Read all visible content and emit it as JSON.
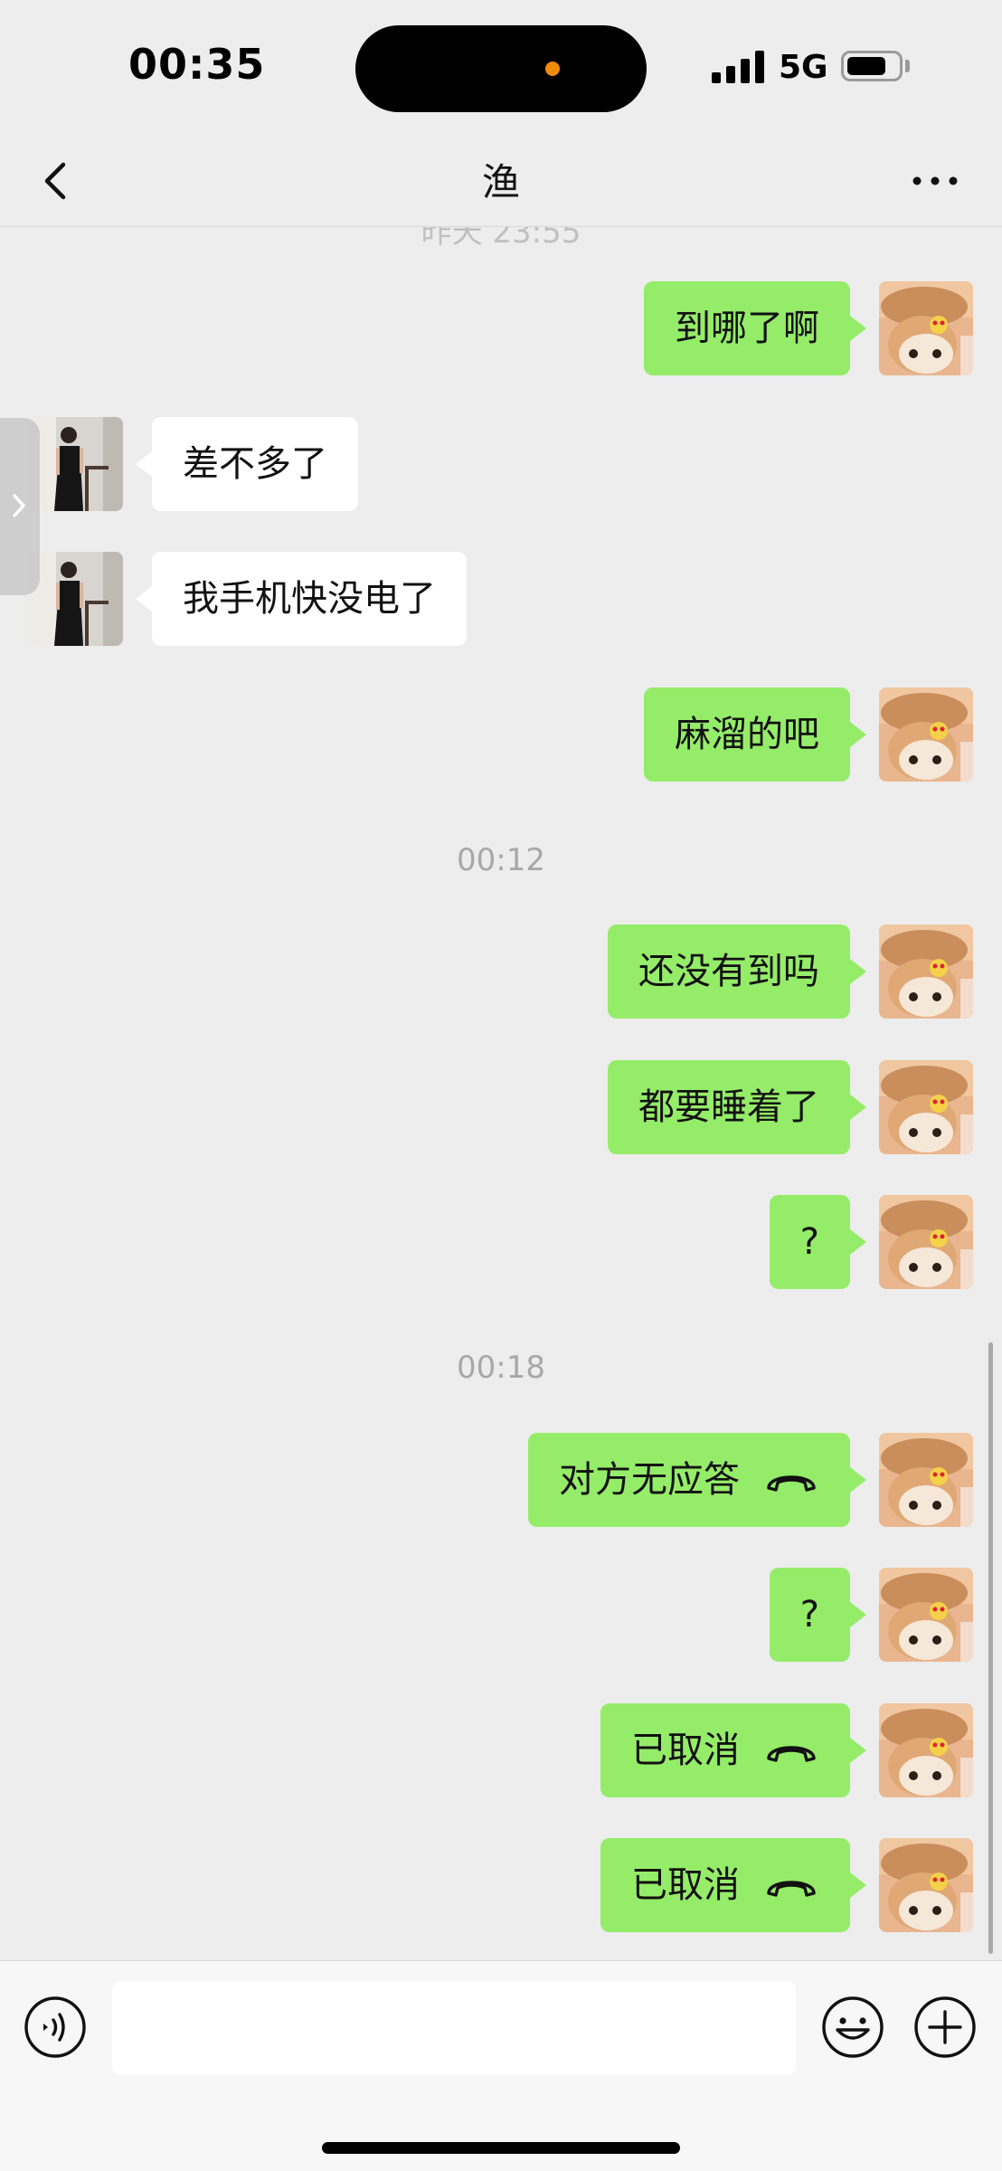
{
  "status_bar": {
    "time": "00:35",
    "network": "5G"
  },
  "header": {
    "title": "渔"
  },
  "chat": {
    "cut_timestamp": "昨天 23:55",
    "timestamps": [
      "00:12",
      "00:18"
    ],
    "messages": [
      {
        "sender": "me",
        "text": "到哪了啊"
      },
      {
        "sender": "them",
        "text": "差不多了"
      },
      {
        "sender": "them",
        "text": "我手机快没电了"
      },
      {
        "sender": "me",
        "text": "麻溜的吧"
      },
      {
        "sender": "me",
        "text": "还没有到吗"
      },
      {
        "sender": "me",
        "text": "都要睡着了"
      },
      {
        "sender": "me",
        "text": "?"
      },
      {
        "sender": "me",
        "text": "对方无应答",
        "icon": "phone-hangup-icon"
      },
      {
        "sender": "me",
        "text": "?"
      },
      {
        "sender": "me",
        "text": "已取消",
        "icon": "phone-hangup-icon"
      },
      {
        "sender": "me",
        "text": "已取消",
        "icon": "phone-hangup-icon"
      }
    ]
  },
  "input": {
    "value": "",
    "placeholder": ""
  },
  "colors": {
    "background": "#ededed",
    "my_bubble": "#95ec69",
    "their_bubble": "#ffffff",
    "island_dot": "#f28a0c"
  },
  "icons": [
    "back-icon",
    "more-icon",
    "voice-icon",
    "emoji-icon",
    "plus-icon",
    "phone-hangup-icon"
  ]
}
